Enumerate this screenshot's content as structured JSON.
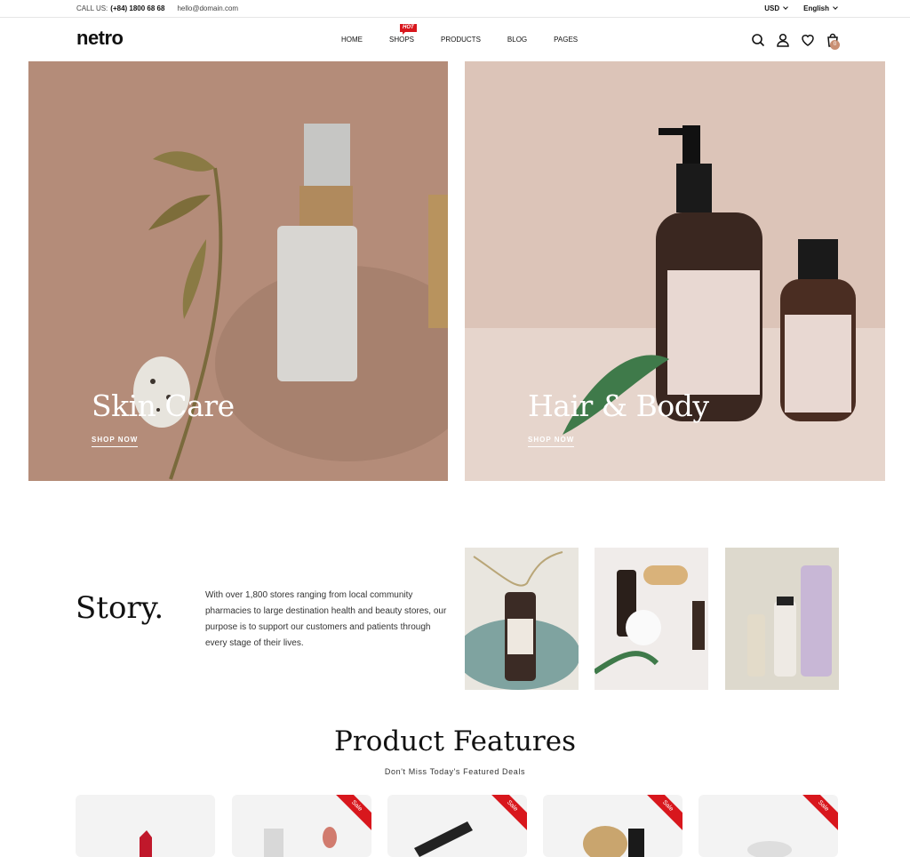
{
  "topbar": {
    "call_label": "CALL US:",
    "phone": "(+84) 1800 68 68",
    "email": "hello@domain.com",
    "currency": "USD",
    "language": "English"
  },
  "header": {
    "logo": "netro",
    "nav": [
      "HOME",
      "SHOPS",
      "PRODUCTS",
      "BLOG",
      "PAGES"
    ],
    "hot_badge": "HOT",
    "cart_count": "0"
  },
  "banners": [
    {
      "title": "Skin Care",
      "link": "SHOP NOW"
    },
    {
      "title": "Hair & Body",
      "link": "SHOP NOW"
    }
  ],
  "story": {
    "title": "Story.",
    "text": "With over 1,800 stores ranging from local community pharmacies to large destination health and beauty stores, our purpose is to support our customers and patients through every stage of their lives."
  },
  "features": {
    "title": "Product Features",
    "subtitle": "Don't Miss Today's Featured Deals",
    "sale_label": "Sale"
  },
  "colors": {
    "accent": "#d8171d",
    "cart_badge": "#c98f73"
  }
}
